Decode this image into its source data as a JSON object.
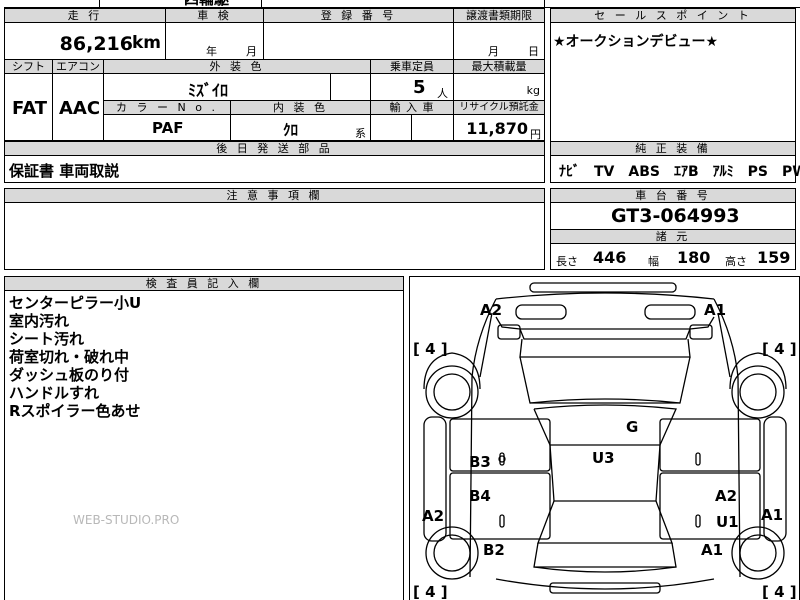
{
  "top_partial": "四輪駆",
  "headers": {
    "mileage": "走 行",
    "inspection": "車 検",
    "registration": "登 録 番 号",
    "transfer_deadline": "譲渡書類期限",
    "sales_point": "セ ー ル ス ポ イ ン ト",
    "shift": "シフト",
    "aircon": "エアコン",
    "exterior_color": "外 装 色",
    "capacity": "乗車定員",
    "max_load": "最大積載量",
    "color_no": "カ ラ ー N o .",
    "interior_color": "内 装 色",
    "import": "輸 入 車",
    "recycle": "リサイクル預託金",
    "later_parts": "後 日 発 送 部 品",
    "equipment": "純 正 装 備",
    "notes": "注 意 事 項 欄",
    "chassis": "車 台 番 号",
    "dimensions": "諸 元",
    "inspector": "検 査 員 記 入 欄"
  },
  "values": {
    "mileage": "86,216",
    "mileage_unit": "km",
    "inspection_year": "年",
    "inspection_month": "月",
    "transfer_month": "月",
    "transfer_day": "日",
    "sales_point": "★オークションデビュー★",
    "shift": "FAT",
    "aircon": "AAC",
    "exterior_color": "ﾐｽﾞｲﾛ",
    "capacity": "5",
    "capacity_unit": "人",
    "max_load_unit": "kg",
    "color_no": "PAF",
    "interior_color": "ｸﾛ",
    "interior_suffix": "系",
    "recycle": "11,870",
    "recycle_unit": "円",
    "later_parts": "保証書 車両取説",
    "equipment": "ﾅﾋﾞ　TV　ABS　ｴｱB　ｱﾙﾐ　PS　PW",
    "chassis": "GT3-064993",
    "length_label": "長さ",
    "length": "446",
    "width_label": "幅",
    "width": "180",
    "height_label": "高さ",
    "height": "159"
  },
  "inspector_notes": [
    "センターピラー小U",
    "室内汚れ",
    "シート汚れ",
    "荷室切れ・破れ中",
    "ダッシュ板のり付",
    "ハンドルすれ",
    "Rスポイラー色あせ"
  ],
  "watermark": "WEB-STUDIO.PRO",
  "diagram": {
    "tires": [
      "[ 4 ]",
      "[ 4 ]",
      "[ 4 ]",
      "[ 4 ]"
    ],
    "marks": {
      "a2_top": "A2",
      "a1_top": "A1",
      "g": "G",
      "u3": "U3",
      "b3": "B3",
      "b4": "B4",
      "a2_right": "A2",
      "u1": "U1",
      "a2_left": "A2",
      "a1_right": "A1",
      "b2": "B2",
      "a1_bottom": "A1"
    }
  }
}
